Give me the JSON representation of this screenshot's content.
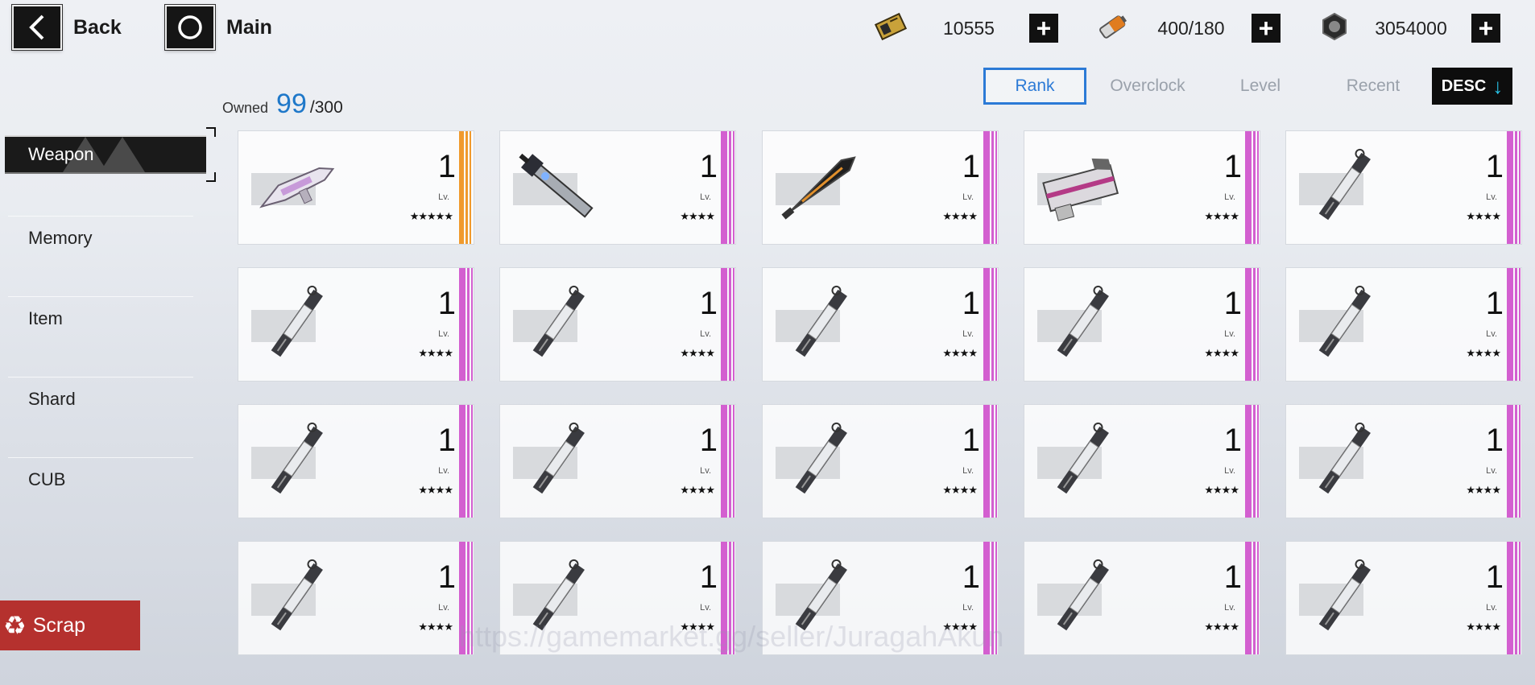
{
  "nav": {
    "back_label": "Back",
    "main_label": "Main"
  },
  "resources": [
    {
      "name": "ticket",
      "value": "10555"
    },
    {
      "name": "battery",
      "value": "400/180"
    },
    {
      "name": "bolt-nut",
      "value": "3054000"
    }
  ],
  "owned": {
    "label": "Owned",
    "count": "99",
    "cap": "/300"
  },
  "sort": {
    "tabs": [
      "Rank",
      "Overclock",
      "Level",
      "Recent"
    ],
    "active": "Rank",
    "order_label": "DESC"
  },
  "sidebar": {
    "items": [
      "Weapon",
      "Memory",
      "Item",
      "Shard",
      "CUB"
    ],
    "active": "Weapon"
  },
  "scrap_label": "Scrap",
  "card_common": {
    "level": "1",
    "lv_tag": "Lv."
  },
  "cards": [
    {
      "icon": "pink-sniper-icon",
      "stars": "★★★★★",
      "rank": "sr"
    },
    {
      "icon": "blade-icon",
      "stars": "★★★★",
      "rank": "r"
    },
    {
      "icon": "dark-blade-icon",
      "stars": "★★★★",
      "rank": "r"
    },
    {
      "icon": "pink-cannon-icon",
      "stars": "★★★★",
      "rank": "r"
    },
    {
      "icon": "sword-icon",
      "stars": "★★★★",
      "rank": "r"
    },
    {
      "icon": "sword-icon",
      "stars": "★★★★",
      "rank": "r"
    },
    {
      "icon": "sword-icon",
      "stars": "★★★★",
      "rank": "r"
    },
    {
      "icon": "sword-icon",
      "stars": "★★★★",
      "rank": "r"
    },
    {
      "icon": "sword-icon",
      "stars": "★★★★",
      "rank": "r"
    },
    {
      "icon": "sword-icon",
      "stars": "★★★★",
      "rank": "r"
    },
    {
      "icon": "sword-icon",
      "stars": "★★★★",
      "rank": "r"
    },
    {
      "icon": "sword-icon",
      "stars": "★★★★",
      "rank": "r"
    },
    {
      "icon": "sword-icon",
      "stars": "★★★★",
      "rank": "r"
    },
    {
      "icon": "sword-icon",
      "stars": "★★★★",
      "rank": "r"
    },
    {
      "icon": "sword-icon",
      "stars": "★★★★",
      "rank": "r"
    },
    {
      "icon": "sword-icon",
      "stars": "★★★★",
      "rank": "r"
    },
    {
      "icon": "sword-icon",
      "stars": "★★★★",
      "rank": "r"
    },
    {
      "icon": "sword-icon",
      "stars": "★★★★",
      "rank": "r"
    },
    {
      "icon": "sword-icon",
      "stars": "★★★★",
      "rank": "r"
    },
    {
      "icon": "sword-icon",
      "stars": "★★★★",
      "rank": "r"
    }
  ],
  "watermark": "https://gamemarket.gg/seller/JuragahAkun",
  "colors": {
    "accent": "#2c7ad6",
    "rank_sr": "#f09a2d",
    "rank_r": "#d35fd0",
    "scrap": "#b5312e"
  }
}
